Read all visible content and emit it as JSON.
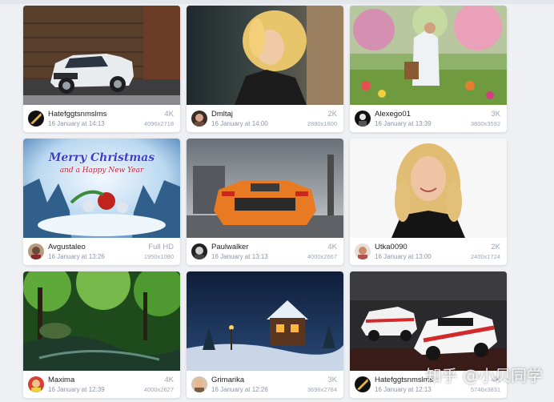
{
  "watermark": "知乎 @小贝同学",
  "cards": [
    {
      "username": "Hatefggtsnmslms",
      "date": "16 January at 14:13",
      "res_label": "4K",
      "res_value": "4096x2718",
      "thumb": "white-pickup-truck-photo",
      "avatar": "avatar-icon"
    },
    {
      "username": "Dmltaj",
      "date": "16 January at 14:00",
      "res_label": "2K",
      "res_value": "2880x1800",
      "thumb": "blonde-woman-portrait-photo",
      "avatar": "avatar-icon"
    },
    {
      "username": "Alexego01",
      "date": "16 January at 13:39",
      "res_label": "3K",
      "res_value": "3800x3592",
      "thumb": "painted-garden-artwork",
      "avatar": "avatar-icon"
    },
    {
      "username": "Avgustaleo",
      "date": "16 January at 13:26",
      "res_label": "Full HD",
      "res_value": "1950x1080",
      "thumb": "christmas-card-artwork",
      "avatar": "avatar-icon",
      "overlay_title": "Merry Christmas",
      "overlay_subtitle": "and a Happy New Year"
    },
    {
      "username": "Paulwalker",
      "date": "16 January at 13:13",
      "res_label": "4K",
      "res_value": "4000x2667",
      "thumb": "orange-sports-car-photo",
      "avatar": "avatar-icon"
    },
    {
      "username": "Utka0090",
      "date": "16 January at 13:00",
      "res_label": "2K",
      "res_value": "2400x1724",
      "thumb": "blonde-woman-smiling-photo",
      "avatar": "avatar-icon"
    },
    {
      "username": "Maxima",
      "date": "16 January at 12:39",
      "res_label": "4K",
      "res_value": "4000x2627",
      "thumb": "forest-river-photo",
      "avatar": "avatar-icon"
    },
    {
      "username": "Grimarika",
      "date": "16 January at 12:26",
      "res_label": "3K",
      "res_value": "3696x2784",
      "thumb": "winter-cabin-night-artwork",
      "avatar": "avatar-icon"
    },
    {
      "username": "Hatefggtsnmslms",
      "date": "16 January at 12:13",
      "res_label": "4K",
      "res_value": "5746x3831",
      "thumb": "racing-cars-garage-photo",
      "avatar": "avatar-icon"
    }
  ]
}
